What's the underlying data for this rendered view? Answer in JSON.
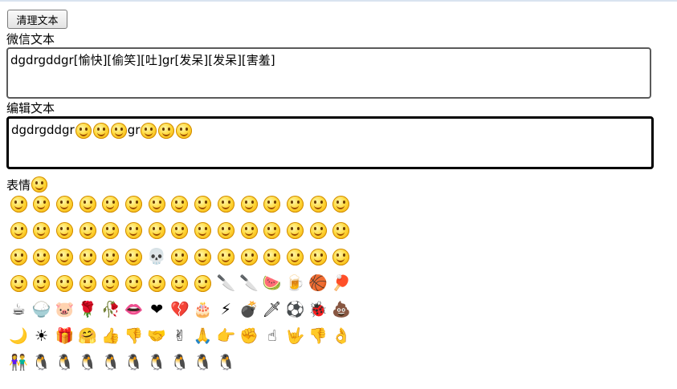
{
  "toolbar": {
    "clear_label": "清理文本"
  },
  "wechat": {
    "label": "微信文本",
    "text": "dgdrgddgr[愉快][偷笑][吐]gr[发呆][发呆][害羞]"
  },
  "editor": {
    "label": "编辑文本",
    "text_a": "dgdrgddgr",
    "emoji_a": [
      "愉快",
      "偷笑",
      "吐"
    ],
    "text_b": "gr",
    "emoji_b": [
      "发呆",
      "发呆",
      "害羞"
    ]
  },
  "emoji_panel": {
    "label": "表情",
    "rows": [
      [
        "smile",
        "pout",
        "heart-eyes",
        "stare",
        "cool",
        "cry",
        "shy",
        "zip",
        "sleep",
        "sob",
        "embarrassed",
        "angry",
        "tongue",
        "grin",
        "surprised"
      ],
      [
        "sad",
        "cool2",
        "cold-sweat",
        "scream",
        "vomit",
        "giggle",
        "pleased",
        "roll-eyes",
        "smug",
        "hungry",
        "sleepy",
        "scared",
        "sweat",
        "laugh",
        "soldier"
      ],
      [
        "struggle",
        "curse",
        "question",
        "shush",
        "dizzy",
        "tormented",
        "skeleton",
        "knock",
        "bye",
        "wipe",
        "pick-nose",
        "applause",
        "awkward",
        "sly",
        "left-hum"
      ],
      [
        "right-hum",
        "yawn",
        "snub",
        "wronged",
        "cry-soon",
        "sneaky",
        "kiss",
        "startled",
        "pitiful",
        "cleaver",
        "knife",
        "watermelon",
        "beer",
        "basketball",
        "pingpong"
      ],
      [
        "coffee",
        "rice",
        "pig",
        "rose",
        "wilt",
        "lips",
        "heart",
        "broken-heart",
        "cake",
        "lightning",
        "bomb",
        "dagger",
        "soccer",
        "ladybug",
        "poop"
      ],
      [
        "moon",
        "sun",
        "gift",
        "hug",
        "thumbs-up",
        "thumbs-down",
        "handshake",
        "victory",
        "fist-salute",
        "beckon",
        "fist",
        "pinky",
        "love-you",
        "no",
        "ok"
      ],
      [
        "couple",
        "jump",
        "shiver",
        "angry-penguin",
        "circle",
        "bow",
        "return",
        "jump-rope",
        "wave",
        "excited"
      ]
    ],
    "glyphs": {
      "coffee": "☕",
      "rice": "🍚",
      "pig": "🐷",
      "rose": "🌹",
      "wilt": "🥀",
      "lips": "👄",
      "heart": "❤",
      "broken-heart": "💔",
      "cake": "🎂",
      "lightning": "⚡",
      "bomb": "💣",
      "dagger": "🗡",
      "soccer": "⚽",
      "ladybug": "🐞",
      "poop": "💩",
      "moon": "🌙",
      "sun": "☀",
      "gift": "🎁",
      "hug": "🤗",
      "thumbs-up": "👍",
      "thumbs-down": "👎",
      "handshake": "🤝",
      "victory": "✌",
      "fist-salute": "🙏",
      "beckon": "👉",
      "fist": "✊",
      "pinky": "☝",
      "love-you": "🤟",
      "no": "👎",
      "ok": "👌",
      "cleaver": "🔪",
      "knife": "🔪",
      "watermelon": "🍉",
      "beer": "🍺",
      "basketball": "🏀",
      "pingpong": "🏓",
      "skeleton": "💀",
      "couple": "👫",
      "jump": "🐧",
      "shiver": "🐧",
      "angry-penguin": "🐧",
      "circle": "🐧",
      "bow": "🐧",
      "return": "🐧",
      "jump-rope": "🐧",
      "wave": "🐧",
      "excited": "🐧"
    }
  }
}
